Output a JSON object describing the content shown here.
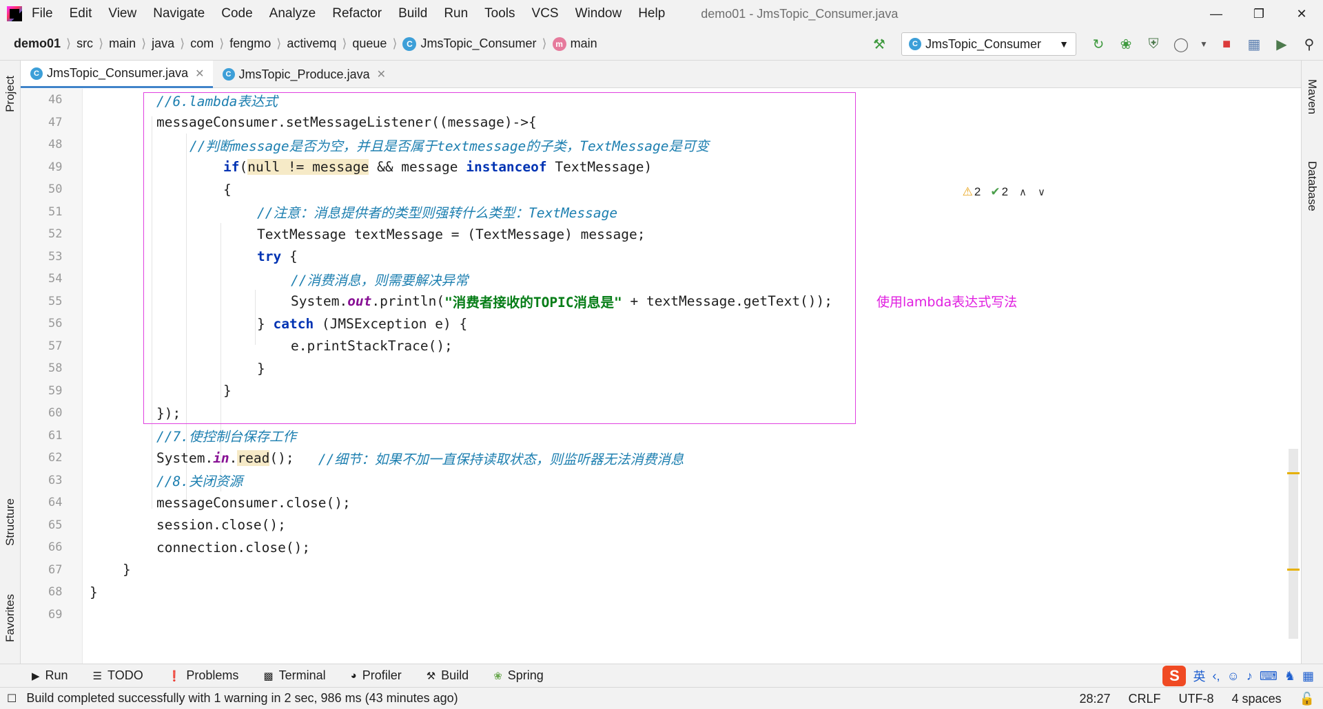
{
  "menu": [
    "File",
    "Edit",
    "View",
    "Navigate",
    "Code",
    "Analyze",
    "Refactor",
    "Build",
    "Run",
    "Tools",
    "VCS",
    "Window",
    "Help"
  ],
  "window_title": "demo01 - JmsTopic_Consumer.java",
  "breadcrumbs": [
    "demo01",
    "src",
    "main",
    "java",
    "com",
    "fengmo",
    "activemq",
    "queue",
    "JmsTopic_Consumer",
    "main"
  ],
  "run_config": "JmsTopic_Consumer",
  "left_tabs": {
    "project": "Project",
    "structure": "Structure",
    "favorites": "Favorites"
  },
  "right_tabs": {
    "maven": "Maven",
    "database": "Database"
  },
  "editor_tabs": [
    "JmsTopic_Consumer.java",
    "JmsTopic_Produce.java"
  ],
  "inspections": {
    "warnings": "2",
    "weak_warnings": "2"
  },
  "line_numbers": [
    "46",
    "47",
    "48",
    "49",
    "50",
    "51",
    "52",
    "53",
    "54",
    "55",
    "56",
    "57",
    "58",
    "59",
    "60",
    "61",
    "62",
    "63",
    "64",
    "65",
    "66",
    "67",
    "68",
    "69"
  ],
  "annotation": "使用lambda表达式写法",
  "code": {
    "l46": "//6.lambda表达式",
    "l47": "messageConsumer.setMessageListener((message)->{",
    "l48": "//判断message是否为空，并且是否属于textmessage的子类，TextMessage是可变",
    "l49_kw": "if",
    "l49_hl": "null != message",
    "l49_rest": " && message ",
    "l49_kw2": "instanceof",
    "l49_end": " TextMessage)",
    "l50": "{",
    "l51": "//注意：消息提供者的类型则强转什么类型：TextMessage",
    "l52": "TextMessage textMessage = (TextMessage) message;",
    "l53_kw": "try",
    "l53_rest": " {",
    "l54": "//消费消息，则需要解决异常",
    "l55_a": "System.",
    "l55_fld": "out",
    "l55_b": ".println(",
    "l55_str": "\"消费者接收的TOPIC消息是\"",
    "l55_c": " + textMessage.getText());",
    "l56_a": "} ",
    "l56_kw": "catch",
    "l56_b": " (JMSException e) {",
    "l57": "e.printStackTrace();",
    "l58": "}",
    "l59": "}",
    "l60": "});",
    "l61": "//7.使控制台保存工作",
    "l62_a": "System.",
    "l62_fld": "in",
    "l62_dot": ".",
    "l62_hl": "read",
    "l62_b": "();   ",
    "l62_cm": "//细节：如果不加一直保持读取状态，则监听器无法消费消息",
    "l63": "//8.关闭资源",
    "l64": "messageConsumer.close();",
    "l65": "session.close();",
    "l66": "connection.close();",
    "l67": "}",
    "l68": "}"
  },
  "bottom_tools": [
    "Run",
    "TODO",
    "Problems",
    "Terminal",
    "Profiler",
    "Build",
    "Spring"
  ],
  "ime": {
    "lang": "英"
  },
  "status": {
    "message": "Build completed successfully with 1 warning in 2 sec, 986 ms (43 minutes ago)",
    "position": "28:27",
    "line_sep": "CRLF",
    "encoding": "UTF-8",
    "indent": "4 spaces"
  },
  "colors": {
    "keyword": "#0033b3",
    "comment": "#1d7fb0",
    "string": "#067d17",
    "annotation": "#e020e0",
    "accent": "#4083c9"
  }
}
